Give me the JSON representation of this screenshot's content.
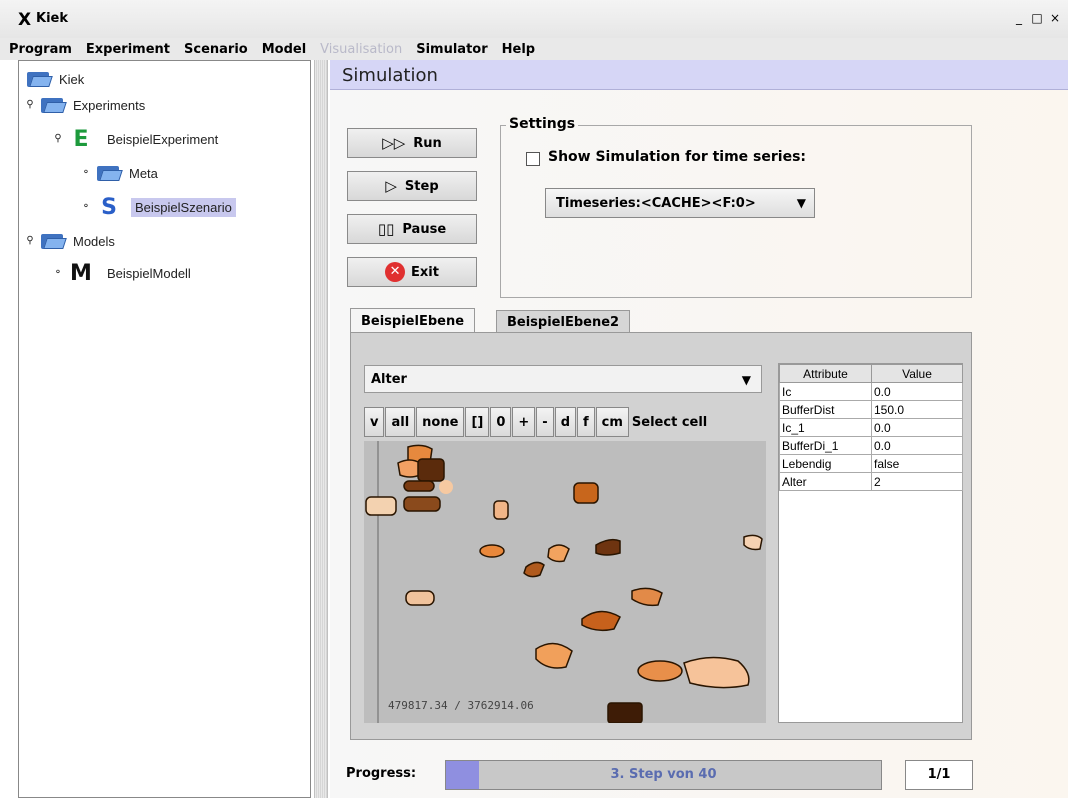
{
  "window": {
    "title": "Kiek",
    "min": "_",
    "max": "□",
    "close": "×"
  },
  "menu": [
    "Program",
    "Experiment",
    "Scenario",
    "Model",
    "Visualisation",
    "Simulator",
    "Help"
  ],
  "tree": {
    "root": "Kiek",
    "experiments": "Experiments",
    "experiment": "BeispielExperiment",
    "meta": "Meta",
    "scenario": "BeispielSzenario",
    "models": "Models",
    "model": "BeispielModell",
    "e_letter": "E",
    "s_letter": "S",
    "m_letter": "M"
  },
  "header": {
    "title": "Simulation"
  },
  "buttons": {
    "run": "Run",
    "step": "Step",
    "pause": "Pause",
    "exit": "Exit"
  },
  "settings": {
    "title": "Settings",
    "checkbox_label": "Show Simulation for time series:",
    "checked": false,
    "timeseries": "Timeseries:<CACHE><F:0>"
  },
  "tabs": [
    "BeispielEbene",
    "BeispielEbene2"
  ],
  "layer": {
    "attribute": "Alter"
  },
  "toolbar": {
    "buttons": [
      "v",
      "all",
      "none",
      "[]",
      "0",
      "+",
      "-",
      "d",
      "f",
      "cm"
    ],
    "label": "Select cell"
  },
  "map": {
    "coords": "479817.34 / 3762914.06"
  },
  "attributes": {
    "headers": [
      "Attribute",
      "Value"
    ],
    "rows": [
      [
        "Ic",
        "0.0"
      ],
      [
        "BufferDist",
        "150.0"
      ],
      [
        "Ic_1",
        "0.0"
      ],
      [
        "BufferDi_1",
        "0.0"
      ],
      [
        "Lebendig",
        "false"
      ],
      [
        "Alter",
        "2"
      ]
    ]
  },
  "progress": {
    "label": "Progress:",
    "text": "3. Step von 40",
    "fraction": 0.075,
    "pages": "1/1"
  },
  "colors": {
    "header_bg": "#d6d6f6",
    "progress_fill": "#8f8fe0",
    "selected": "#c8c8ee"
  }
}
